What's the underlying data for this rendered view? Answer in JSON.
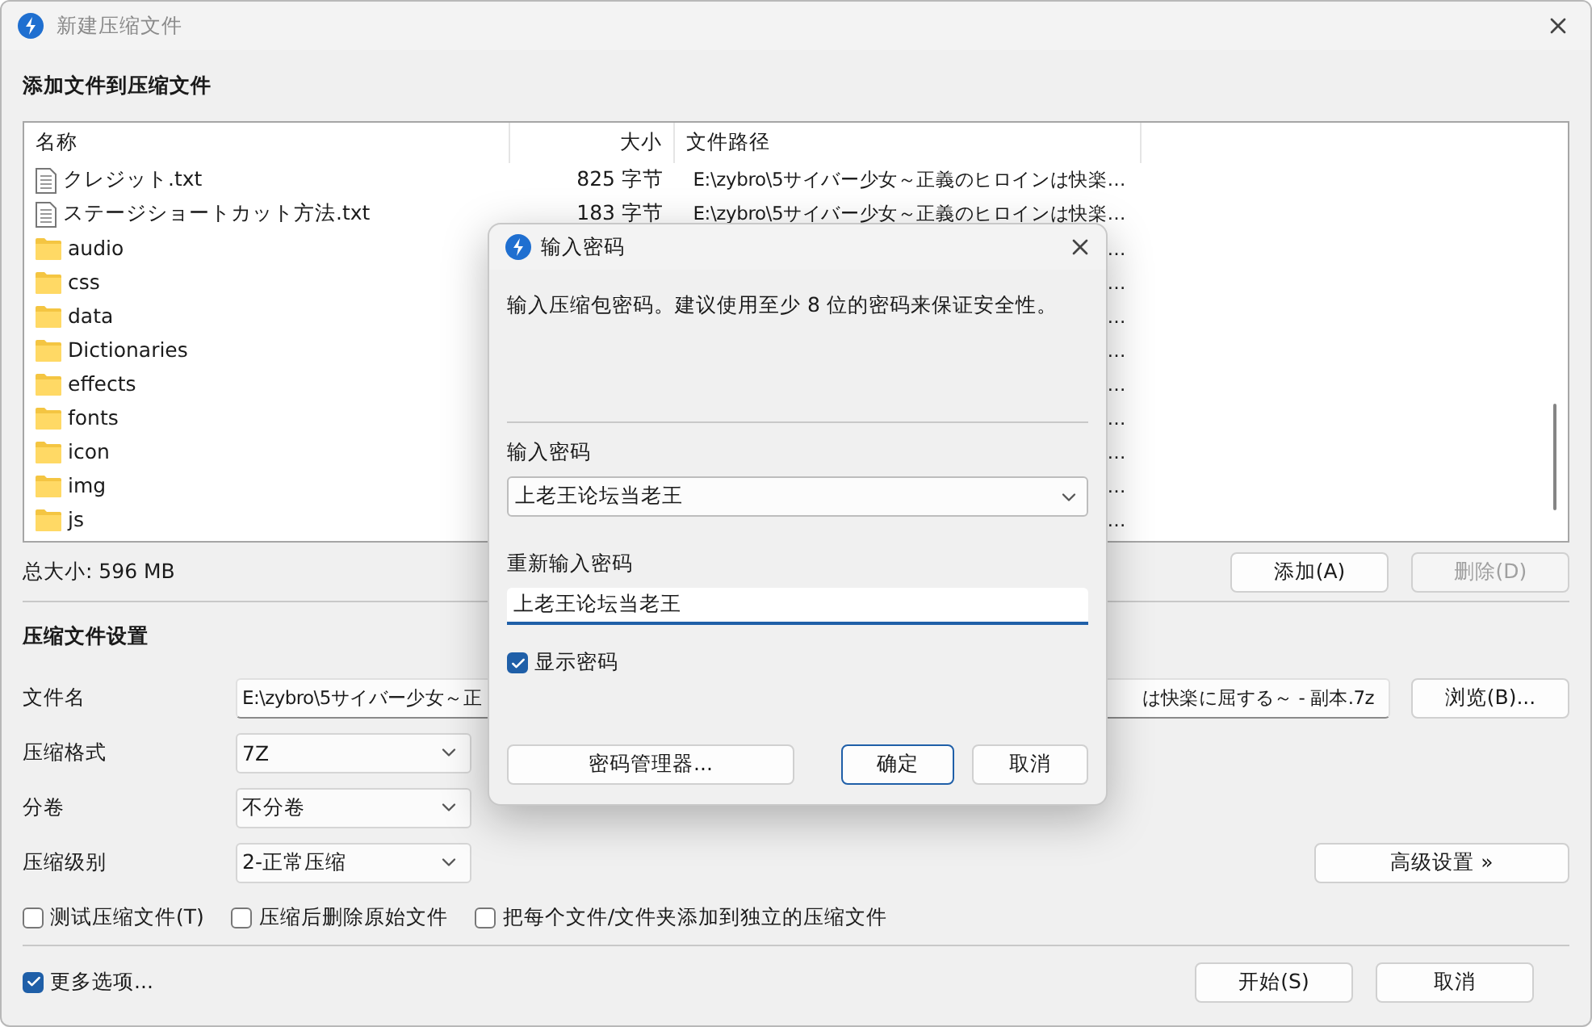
{
  "window": {
    "title": "新建压缩文件"
  },
  "files_section": {
    "heading": "添加文件到压缩文件",
    "columns": [
      "名称",
      "大小",
      "文件路径"
    ],
    "rows": [
      {
        "kind": "file",
        "name": "クレジット.txt",
        "size": "825 字节",
        "path": "E:\\zybro\\5サイバー少女～正義のヒロインは快楽…"
      },
      {
        "kind": "file",
        "name": "ステージショートカット方法.txt",
        "size": "183 字节",
        "path": "E:\\zybro\\5サイバー少女～正義のヒロインは快楽…"
      },
      {
        "kind": "folder",
        "name": "audio",
        "path": "…"
      },
      {
        "kind": "folder",
        "name": "css",
        "path": "…"
      },
      {
        "kind": "folder",
        "name": "data",
        "path": "…"
      },
      {
        "kind": "folder",
        "name": "Dictionaries",
        "path": "…"
      },
      {
        "kind": "folder",
        "name": "effects",
        "path": "…"
      },
      {
        "kind": "folder",
        "name": "fonts",
        "path": "…"
      },
      {
        "kind": "folder",
        "name": "icon",
        "path": "…"
      },
      {
        "kind": "folder",
        "name": "img",
        "path": "…"
      },
      {
        "kind": "folder",
        "name": "js",
        "path": "…"
      }
    ],
    "total": "总大小: 596 MB",
    "buttons": [
      {
        "label": "添加(A)",
        "disabled": false
      },
      {
        "label": "删除(D)",
        "disabled": true
      }
    ]
  },
  "settings": {
    "heading": "压缩文件设置",
    "filename": {
      "label": "文件名",
      "value_start": "E:\\zybro\\5サイバー少女～正",
      "value_end": "は快楽に屈する～ - 副本.7z"
    },
    "browse_button": "浏览(B)...",
    "selects": [
      {
        "label": "压缩格式",
        "value": "7Z"
      },
      {
        "label": "分卷",
        "value": "不分卷"
      },
      {
        "label": "压缩级别",
        "value": "2-正常压缩"
      }
    ],
    "advanced_button": "高级设置 »",
    "options": [
      {
        "label": "测试压缩文件(T)",
        "checked": false
      },
      {
        "label": "压缩后删除原始文件",
        "checked": false
      },
      {
        "label": "把每个文件/文件夹添加到独立的压缩文件",
        "checked": false
      }
    ]
  },
  "footer": {
    "more_options": {
      "label": "更多选项...",
      "checked": true
    },
    "buttons": [
      "开始(S)",
      "取消"
    ]
  },
  "dialog": {
    "title": "输入密码",
    "message": "输入压缩包密码。建议使用至少 8 位的密码来保证安全性。",
    "password_label": "输入密码",
    "password_value": "上老王论坛当老王",
    "confirm_label": "重新输入密码",
    "confirm_value": "上老王论坛当老王",
    "show_password": {
      "label": "显示密码",
      "checked": true
    },
    "buttons": [
      {
        "label": "密码管理器...",
        "kind": "wide"
      },
      {
        "label": "确定",
        "kind": "default"
      },
      {
        "label": "取消",
        "kind": "normal"
      }
    ]
  }
}
